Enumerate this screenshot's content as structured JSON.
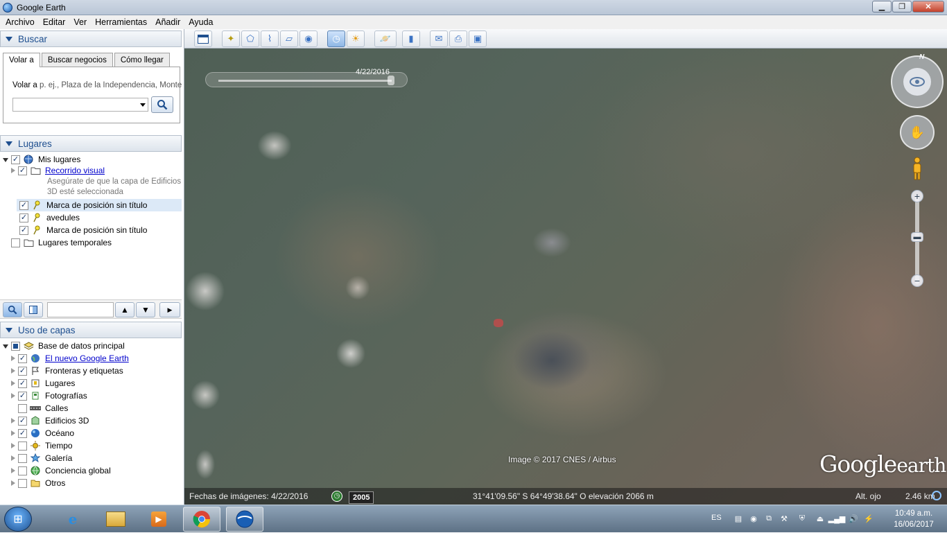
{
  "window": {
    "title": "Google Earth"
  },
  "window_buttons": {
    "minimize": "▁",
    "maximize": "❐",
    "close": "✕"
  },
  "menu": [
    "Archivo",
    "Editar",
    "Ver",
    "Herramientas",
    "Añadir",
    "Ayuda"
  ],
  "search": {
    "header": "Buscar",
    "tabs": [
      "Volar a",
      "Buscar negocios",
      "Cómo llegar"
    ],
    "fly_label": "Volar a",
    "fly_placeholder": "p. ej., Plaza de la Independencia, Monte",
    "input_value": ""
  },
  "places": {
    "header": "Lugares",
    "items": [
      {
        "label": "Mis lugares",
        "checked": true,
        "icon": "globe-icon"
      },
      {
        "label": "Recorrido visual",
        "checked": true,
        "icon": "folder-icon",
        "link": true
      },
      {
        "label": "Marca de posición sin título",
        "checked": true,
        "icon": "pushpin-icon",
        "selected": true
      },
      {
        "label": "avedules",
        "checked": true,
        "icon": "pushpin-icon"
      },
      {
        "label": "Marca de posición sin título",
        "checked": true,
        "icon": "pushpin-icon"
      },
      {
        "label": "Lugares temporales",
        "checked": false,
        "icon": "folder-icon"
      }
    ],
    "tour_note_line1": "Asegúrate de que la capa de Edificios",
    "tour_note_line2": "3D esté seleccionada"
  },
  "layers": {
    "header": "Uso de capas",
    "root": "Base de datos principal",
    "items": [
      {
        "label": "El nuevo Google Earth",
        "checked": true,
        "link": true,
        "icon": "earth-icon"
      },
      {
        "label": "Fronteras y etiquetas",
        "checked": true,
        "icon": "flag-icon"
      },
      {
        "label": "Lugares",
        "checked": true,
        "icon": "places-icon"
      },
      {
        "label": "Fotografías",
        "checked": true,
        "icon": "photo-icon"
      },
      {
        "label": "Calles",
        "checked": false,
        "icon": "road-icon"
      },
      {
        "label": "Edificios 3D",
        "checked": true,
        "icon": "building-icon"
      },
      {
        "label": "Océano",
        "checked": true,
        "icon": "ocean-icon"
      },
      {
        "label": "Tiempo",
        "checked": false,
        "icon": "sun-icon"
      },
      {
        "label": "Galería",
        "checked": false,
        "icon": "star-icon"
      },
      {
        "label": "Conciencia global",
        "checked": false,
        "icon": "globe-icon"
      },
      {
        "label": "Otros",
        "checked": false,
        "icon": "folder-icon"
      }
    ]
  },
  "map": {
    "time_slider_date": "4/22/2016",
    "compass_label": "N",
    "copyright": "Image © 2017 CNES / Airbus",
    "logo_google": "Google",
    "logo_earth": "earth",
    "zoom_in": "+",
    "zoom_out": "−"
  },
  "status": {
    "imagery_date": "Fechas de imágenes: 4/22/2016",
    "year": "2005",
    "coordinates": "31°41'09.56\" S  64°49'38.64\" O elevación  2066 m",
    "eye_alt_label": "Alt. ojo",
    "eye_alt_value": "2.46 km"
  },
  "taskbar": {
    "language": "ES",
    "time": "10:49 a.m.",
    "date": "16/06/2017"
  }
}
